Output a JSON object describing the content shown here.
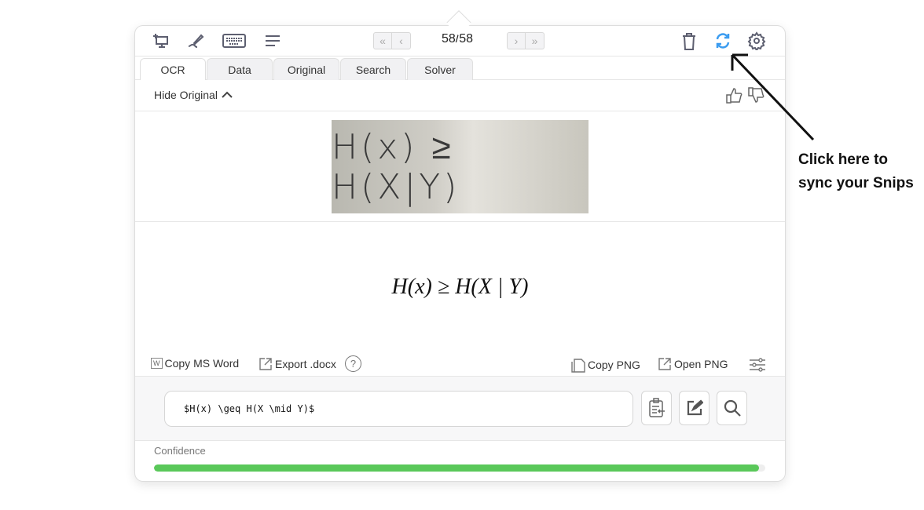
{
  "toolbar": {
    "icons": [
      "screen-snip-icon",
      "pen-icon",
      "keyboard-icon",
      "menu-lines-icon"
    ],
    "counter": "58/58",
    "first": "«",
    "prev": "‹",
    "next": "›",
    "last": "»"
  },
  "tabs": [
    {
      "label": "OCR",
      "active": true
    },
    {
      "label": "Data"
    },
    {
      "label": "Original"
    },
    {
      "label": "Search"
    },
    {
      "label": "Solver"
    }
  ],
  "hide_original": "Hide Original",
  "snip_handwriting": "H(x) ≥ H(X|Y)",
  "rendered_math": "H(x) ≥ H(X | Y)",
  "actions": {
    "copy_word": "Copy MS Word",
    "export_docx": "Export .docx",
    "copy_png": "Copy PNG",
    "open_png": "Open PNG"
  },
  "latex_value": "$H(x) \\geq H(X \\mid Y)$",
  "confidence": {
    "label": "Confidence",
    "value": 0.99,
    "color": "#5ac85a"
  },
  "annotation": "Click here to sync your Snips",
  "colors": {
    "sync": "#3b9cf0"
  }
}
